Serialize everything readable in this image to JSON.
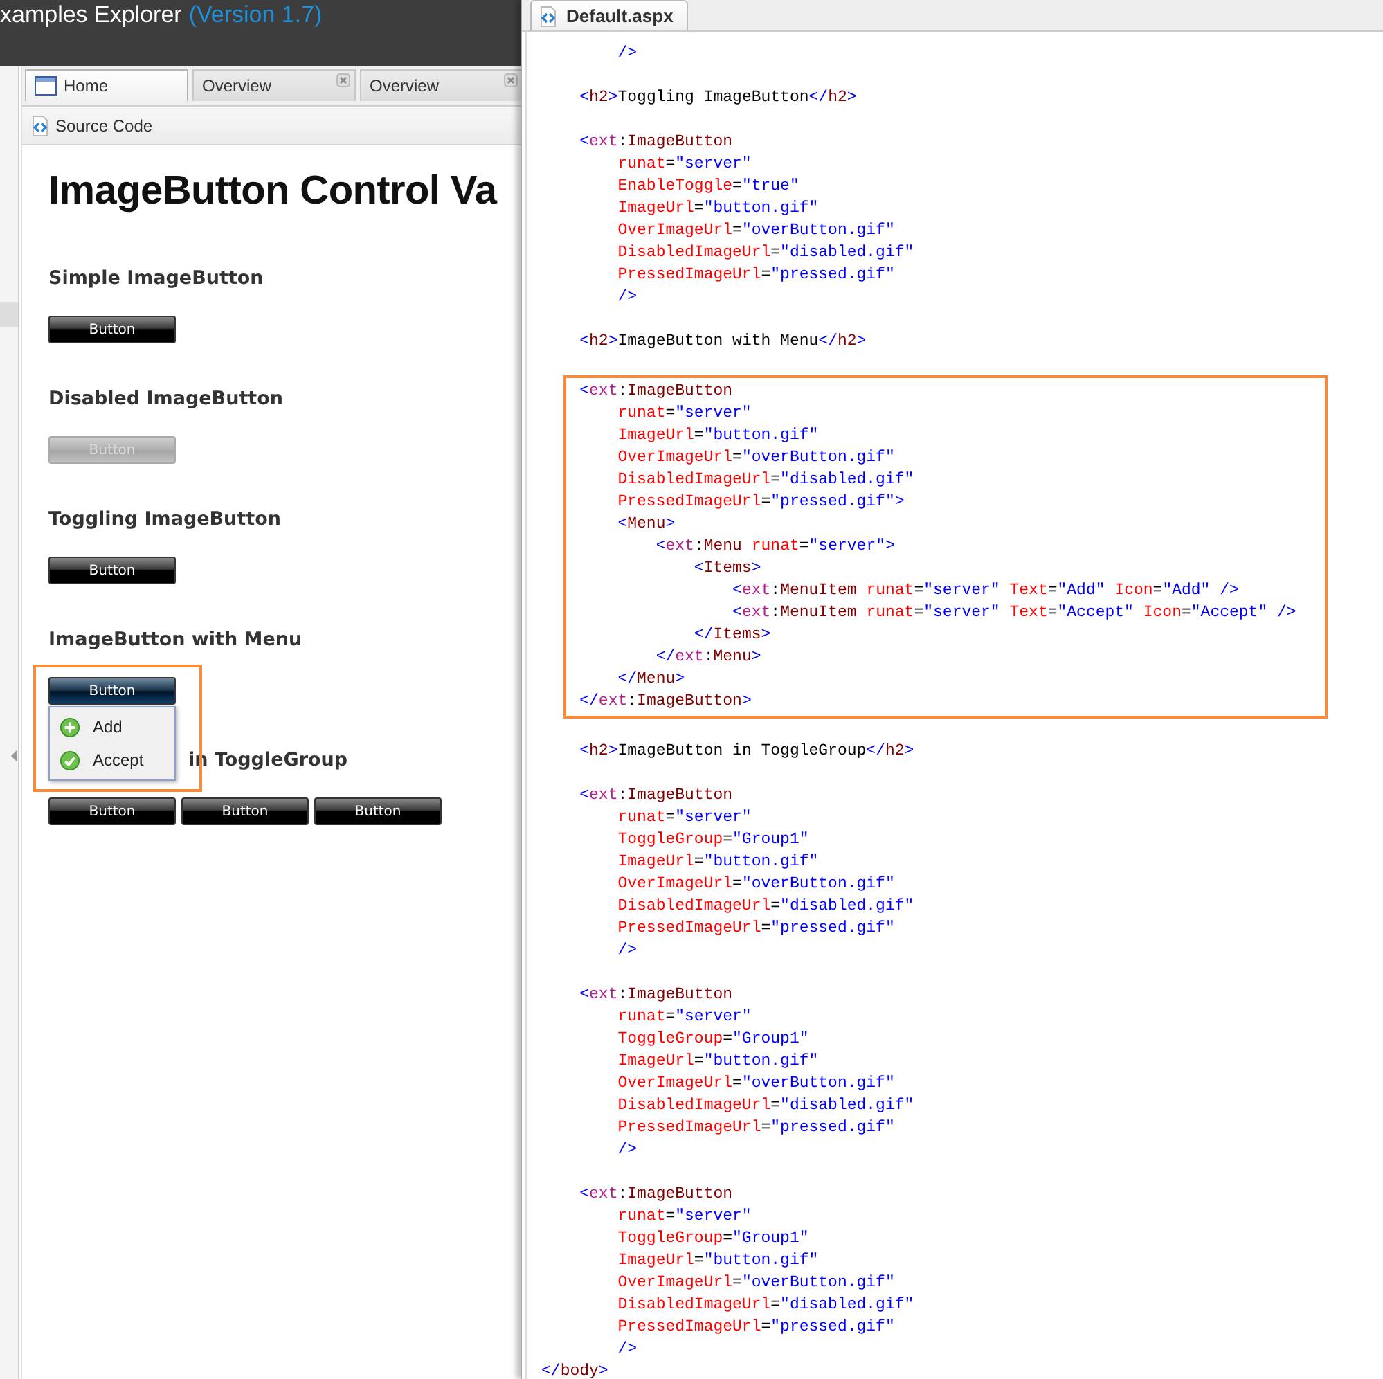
{
  "header": {
    "title": "xamples Explorer",
    "version": "(Version 1.7)"
  },
  "tabs": [
    {
      "label": "Home",
      "closable": false,
      "selected": true
    },
    {
      "label": "Overview",
      "closable": true,
      "selected": false
    },
    {
      "label": "Overview",
      "closable": true,
      "selected": false
    }
  ],
  "toolbar": {
    "button": "Source Code"
  },
  "demo": {
    "title": "ImageButton Control Va",
    "sections": [
      {
        "heading": "Simple ImageButton",
        "highlighted": false,
        "buttons": [
          {
            "label": "Button",
            "disabled": false,
            "active": false
          }
        ]
      },
      {
        "heading": "Disabled ImageButton",
        "highlighted": false,
        "buttons": [
          {
            "label": "Button",
            "disabled": true,
            "active": false
          }
        ]
      },
      {
        "heading": "Toggling ImageButton",
        "highlighted": false,
        "buttons": [
          {
            "label": "Button",
            "disabled": false,
            "active": false
          }
        ]
      },
      {
        "heading": "ImageButton with Menu",
        "highlighted": true,
        "buttons": [
          {
            "label": "Button",
            "disabled": false,
            "active": true
          }
        ],
        "menu": [
          {
            "label": "Add"
          },
          {
            "label": "Accept"
          }
        ]
      },
      {
        "heading": "in ToggleGroup",
        "highlighted": false,
        "buttons": [
          {
            "label": "Button",
            "disabled": false,
            "active": false
          },
          {
            "label": "Button",
            "disabled": false,
            "active": false
          },
          {
            "label": "Button",
            "disabled": false,
            "active": false
          }
        ]
      }
    ]
  },
  "source": {
    "tab": "Default.aspx",
    "sections": [
      {
        "highlighted": false,
        "paragraphs": [
          [
            [
              {
                "kind": "punct",
                "text": "        />"
              }
            ]
          ],
          [
            [
              {
                "kind": "punct",
                "text": "    <"
              },
              {
                "kind": "tag",
                "text": "h2"
              },
              {
                "kind": "punct",
                "text": ">"
              },
              {
                "kind": "text",
                "text": "Toggling ImageButton"
              },
              {
                "kind": "punct",
                "text": "</"
              },
              {
                "kind": "tag",
                "text": "h2"
              },
              {
                "kind": "punct",
                "text": ">"
              }
            ]
          ],
          [
            [
              {
                "kind": "punct",
                "text": "    <"
              },
              {
                "kind": "ns",
                "text": "ext"
              },
              {
                "kind": "text",
                "text": ":"
              },
              {
                "kind": "tag",
                "text": "ImageButton"
              }
            ],
            [
              {
                "kind": "attr",
                "text": "        runat"
              },
              {
                "kind": "text",
                "text": "="
              },
              {
                "kind": "value",
                "text": "\"server\""
              }
            ],
            [
              {
                "kind": "attr",
                "text": "        EnableToggle"
              },
              {
                "kind": "text",
                "text": "="
              },
              {
                "kind": "value",
                "text": "\"true\""
              }
            ],
            [
              {
                "kind": "attr",
                "text": "        ImageUrl"
              },
              {
                "kind": "text",
                "text": "="
              },
              {
                "kind": "value",
                "text": "\"button.gif\""
              }
            ],
            [
              {
                "kind": "attr",
                "text": "        OverImageUrl"
              },
              {
                "kind": "text",
                "text": "="
              },
              {
                "kind": "value",
                "text": "\"overButton.gif\""
              }
            ],
            [
              {
                "kind": "attr",
                "text": "        DisabledImageUrl"
              },
              {
                "kind": "text",
                "text": "="
              },
              {
                "kind": "value",
                "text": "\"disabled.gif\""
              }
            ],
            [
              {
                "kind": "attr",
                "text": "        PressedImageUrl"
              },
              {
                "kind": "text",
                "text": "="
              },
              {
                "kind": "value",
                "text": "\"pressed.gif\""
              }
            ],
            [
              {
                "kind": "punct",
                "text": "        />"
              }
            ]
          ],
          [
            [
              {
                "kind": "punct",
                "text": "    <"
              },
              {
                "kind": "tag",
                "text": "h2"
              },
              {
                "kind": "punct",
                "text": ">"
              },
              {
                "kind": "text",
                "text": "ImageButton with Menu"
              },
              {
                "kind": "punct",
                "text": "</"
              },
              {
                "kind": "tag",
                "text": "h2"
              },
              {
                "kind": "punct",
                "text": ">"
              }
            ]
          ]
        ]
      },
      {
        "highlighted": true,
        "paragraphs": [
          [
            [
              {
                "kind": "punct",
                "text": "    <"
              },
              {
                "kind": "ns",
                "text": "ext"
              },
              {
                "kind": "text",
                "text": ":"
              },
              {
                "kind": "tag",
                "text": "ImageButton"
              }
            ],
            [
              {
                "kind": "attr",
                "text": "        runat"
              },
              {
                "kind": "text",
                "text": "="
              },
              {
                "kind": "value",
                "text": "\"server\""
              }
            ],
            [
              {
                "kind": "attr",
                "text": "        ImageUrl"
              },
              {
                "kind": "text",
                "text": "="
              },
              {
                "kind": "value",
                "text": "\"button.gif\""
              }
            ],
            [
              {
                "kind": "attr",
                "text": "        OverImageUrl"
              },
              {
                "kind": "text",
                "text": "="
              },
              {
                "kind": "value",
                "text": "\"overButton.gif\""
              }
            ],
            [
              {
                "kind": "attr",
                "text": "        DisabledImageUrl"
              },
              {
                "kind": "text",
                "text": "="
              },
              {
                "kind": "value",
                "text": "\"disabled.gif\""
              }
            ],
            [
              {
                "kind": "attr",
                "text": "        PressedImageUrl"
              },
              {
                "kind": "text",
                "text": "="
              },
              {
                "kind": "value",
                "text": "\"pressed.gif\""
              },
              {
                "kind": "punct",
                "text": ">"
              }
            ],
            [
              {
                "kind": "punct",
                "text": "        <"
              },
              {
                "kind": "tag",
                "text": "Menu"
              },
              {
                "kind": "punct",
                "text": ">"
              }
            ],
            [
              {
                "kind": "punct",
                "text": "            <"
              },
              {
                "kind": "ns",
                "text": "ext"
              },
              {
                "kind": "text",
                "text": ":"
              },
              {
                "kind": "tag",
                "text": "Menu "
              },
              {
                "kind": "attr",
                "text": "runat"
              },
              {
                "kind": "text",
                "text": "="
              },
              {
                "kind": "value",
                "text": "\"server\""
              },
              {
                "kind": "punct",
                "text": ">"
              }
            ],
            [
              {
                "kind": "punct",
                "text": "                <"
              },
              {
                "kind": "tag",
                "text": "Items"
              },
              {
                "kind": "punct",
                "text": ">"
              }
            ],
            [
              {
                "kind": "punct",
                "text": "                    <"
              },
              {
                "kind": "ns",
                "text": "ext"
              },
              {
                "kind": "text",
                "text": ":"
              },
              {
                "kind": "tag",
                "text": "MenuItem "
              },
              {
                "kind": "attr",
                "text": "runat"
              },
              {
                "kind": "text",
                "text": "="
              },
              {
                "kind": "value",
                "text": "\"server\" "
              },
              {
                "kind": "attr",
                "text": "Text"
              },
              {
                "kind": "text",
                "text": "="
              },
              {
                "kind": "value",
                "text": "\"Add\" "
              },
              {
                "kind": "attr",
                "text": "Icon"
              },
              {
                "kind": "text",
                "text": "="
              },
              {
                "kind": "value",
                "text": "\"Add\" "
              },
              {
                "kind": "punct",
                "text": "/>"
              }
            ],
            [
              {
                "kind": "punct",
                "text": "                    <"
              },
              {
                "kind": "ns",
                "text": "ext"
              },
              {
                "kind": "text",
                "text": ":"
              },
              {
                "kind": "tag",
                "text": "MenuItem "
              },
              {
                "kind": "attr",
                "text": "runat"
              },
              {
                "kind": "text",
                "text": "="
              },
              {
                "kind": "value",
                "text": "\"server\" "
              },
              {
                "kind": "attr",
                "text": "Text"
              },
              {
                "kind": "text",
                "text": "="
              },
              {
                "kind": "value",
                "text": "\"Accept\" "
              },
              {
                "kind": "attr",
                "text": "Icon"
              },
              {
                "kind": "text",
                "text": "="
              },
              {
                "kind": "value",
                "text": "\"Accept\" "
              },
              {
                "kind": "punct",
                "text": "/>"
              }
            ],
            [
              {
                "kind": "punct",
                "text": "                </"
              },
              {
                "kind": "tag",
                "text": "Items"
              },
              {
                "kind": "punct",
                "text": ">"
              }
            ],
            [
              {
                "kind": "punct",
                "text": "            </"
              },
              {
                "kind": "ns",
                "text": "ext"
              },
              {
                "kind": "text",
                "text": ":"
              },
              {
                "kind": "tag",
                "text": "Menu"
              },
              {
                "kind": "punct",
                "text": ">"
              }
            ],
            [
              {
                "kind": "punct",
                "text": "        </"
              },
              {
                "kind": "tag",
                "text": "Menu"
              },
              {
                "kind": "punct",
                "text": ">"
              }
            ],
            [
              {
                "kind": "punct",
                "text": "    </"
              },
              {
                "kind": "ns",
                "text": "ext"
              },
              {
                "kind": "text",
                "text": ":"
              },
              {
                "kind": "tag",
                "text": "ImageButton"
              },
              {
                "kind": "punct",
                "text": ">"
              }
            ]
          ]
        ]
      },
      {
        "highlighted": false,
        "paragraphs": [
          [
            [
              {
                "kind": "punct",
                "text": "    <"
              },
              {
                "kind": "tag",
                "text": "h2"
              },
              {
                "kind": "punct",
                "text": ">"
              },
              {
                "kind": "text",
                "text": "ImageButton in ToggleGroup"
              },
              {
                "kind": "punct",
                "text": "</"
              },
              {
                "kind": "tag",
                "text": "h2"
              },
              {
                "kind": "punct",
                "text": ">"
              }
            ]
          ],
          [
            [
              {
                "kind": "punct",
                "text": "    <"
              },
              {
                "kind": "ns",
                "text": "ext"
              },
              {
                "kind": "text",
                "text": ":"
              },
              {
                "kind": "tag",
                "text": "ImageButton"
              }
            ],
            [
              {
                "kind": "attr",
                "text": "        runat"
              },
              {
                "kind": "text",
                "text": "="
              },
              {
                "kind": "value",
                "text": "\"server\""
              }
            ],
            [
              {
                "kind": "attr",
                "text": "        ToggleGroup"
              },
              {
                "kind": "text",
                "text": "="
              },
              {
                "kind": "value",
                "text": "\"Group1\""
              }
            ],
            [
              {
                "kind": "attr",
                "text": "        ImageUrl"
              },
              {
                "kind": "text",
                "text": "="
              },
              {
                "kind": "value",
                "text": "\"button.gif\""
              }
            ],
            [
              {
                "kind": "attr",
                "text": "        OverImageUrl"
              },
              {
                "kind": "text",
                "text": "="
              },
              {
                "kind": "value",
                "text": "\"overButton.gif\""
              }
            ],
            [
              {
                "kind": "attr",
                "text": "        DisabledImageUrl"
              },
              {
                "kind": "text",
                "text": "="
              },
              {
                "kind": "value",
                "text": "\"disabled.gif\""
              }
            ],
            [
              {
                "kind": "attr",
                "text": "        PressedImageUrl"
              },
              {
                "kind": "text",
                "text": "="
              },
              {
                "kind": "value",
                "text": "\"pressed.gif\""
              }
            ],
            [
              {
                "kind": "punct",
                "text": "        />"
              }
            ]
          ],
          [
            [
              {
                "kind": "punct",
                "text": "    <"
              },
              {
                "kind": "ns",
                "text": "ext"
              },
              {
                "kind": "text",
                "text": ":"
              },
              {
                "kind": "tag",
                "text": "ImageButton"
              }
            ],
            [
              {
                "kind": "attr",
                "text": "        runat"
              },
              {
                "kind": "text",
                "text": "="
              },
              {
                "kind": "value",
                "text": "\"server\""
              }
            ],
            [
              {
                "kind": "attr",
                "text": "        ToggleGroup"
              },
              {
                "kind": "text",
                "text": "="
              },
              {
                "kind": "value",
                "text": "\"Group1\""
              }
            ],
            [
              {
                "kind": "attr",
                "text": "        ImageUrl"
              },
              {
                "kind": "text",
                "text": "="
              },
              {
                "kind": "value",
                "text": "\"button.gif\""
              }
            ],
            [
              {
                "kind": "attr",
                "text": "        OverImageUrl"
              },
              {
                "kind": "text",
                "text": "="
              },
              {
                "kind": "value",
                "text": "\"overButton.gif\""
              }
            ],
            [
              {
                "kind": "attr",
                "text": "        DisabledImageUrl"
              },
              {
                "kind": "text",
                "text": "="
              },
              {
                "kind": "value",
                "text": "\"disabled.gif\""
              }
            ],
            [
              {
                "kind": "attr",
                "text": "        PressedImageUrl"
              },
              {
                "kind": "text",
                "text": "="
              },
              {
                "kind": "value",
                "text": "\"pressed.gif\""
              }
            ],
            [
              {
                "kind": "punct",
                "text": "        />"
              }
            ]
          ],
          [
            [
              {
                "kind": "punct",
                "text": "    <"
              },
              {
                "kind": "ns",
                "text": "ext"
              },
              {
                "kind": "text",
                "text": ":"
              },
              {
                "kind": "tag",
                "text": "ImageButton"
              }
            ],
            [
              {
                "kind": "attr",
                "text": "        runat"
              },
              {
                "kind": "text",
                "text": "="
              },
              {
                "kind": "value",
                "text": "\"server\""
              }
            ],
            [
              {
                "kind": "attr",
                "text": "        ToggleGroup"
              },
              {
                "kind": "text",
                "text": "="
              },
              {
                "kind": "value",
                "text": "\"Group1\""
              }
            ],
            [
              {
                "kind": "attr",
                "text": "        ImageUrl"
              },
              {
                "kind": "text",
                "text": "="
              },
              {
                "kind": "value",
                "text": "\"button.gif\""
              }
            ],
            [
              {
                "kind": "attr",
                "text": "        OverImageUrl"
              },
              {
                "kind": "text",
                "text": "="
              },
              {
                "kind": "value",
                "text": "\"overButton.gif\""
              }
            ],
            [
              {
                "kind": "attr",
                "text": "        DisabledImageUrl"
              },
              {
                "kind": "text",
                "text": "="
              },
              {
                "kind": "value",
                "text": "\"disabled.gif\""
              }
            ],
            [
              {
                "kind": "attr",
                "text": "        PressedImageUrl"
              },
              {
                "kind": "text",
                "text": "="
              },
              {
                "kind": "value",
                "text": "\"pressed.gif\""
              }
            ],
            [
              {
                "kind": "punct",
                "text": "        />"
              }
            ],
            [
              {
                "kind": "punct",
                "text": "</"
              },
              {
                "kind": "tag",
                "text": "body"
              },
              {
                "kind": "punct",
                "text": ">"
              }
            ]
          ]
        ]
      }
    ]
  }
}
